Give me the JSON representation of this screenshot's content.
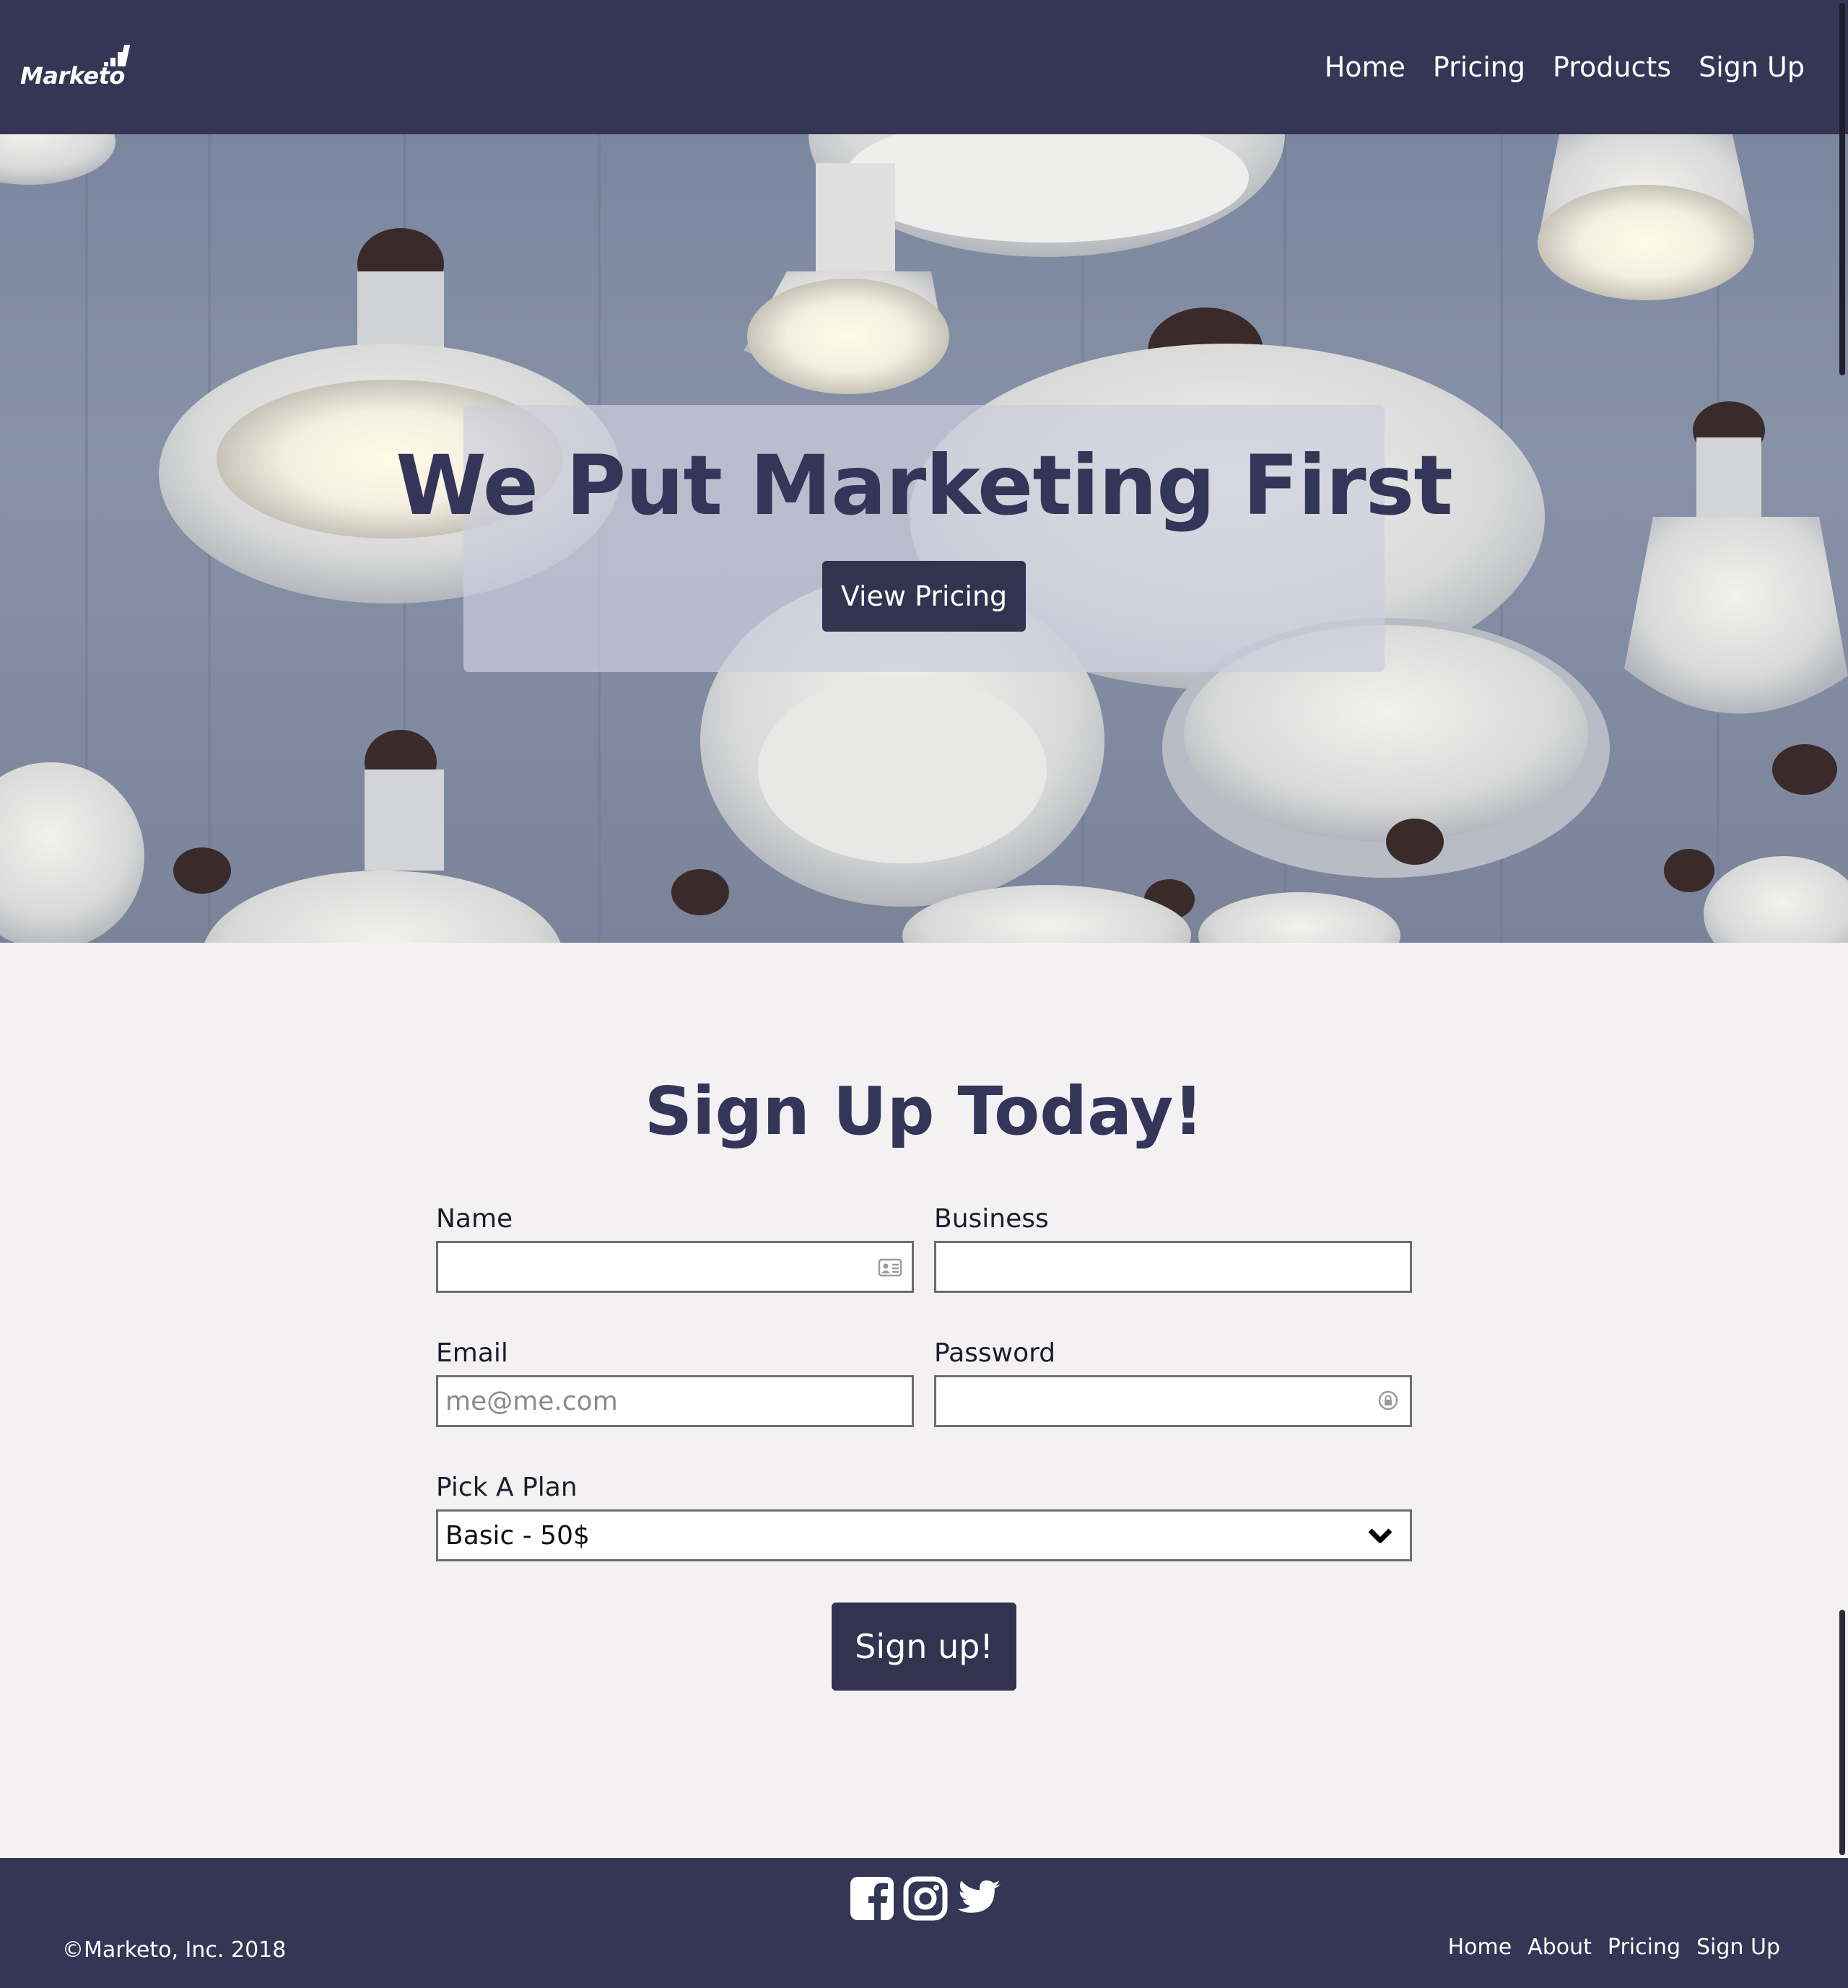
{
  "navbar": {
    "logo_text": "Marketo",
    "links": [
      "Home",
      "Pricing",
      "Products",
      "Sign Up"
    ]
  },
  "hero": {
    "title": "We Put Marketing First",
    "button_label": "View Pricing"
  },
  "signup": {
    "title": "Sign Up Today!",
    "name_label": "Name",
    "business_label": "Business",
    "email_label": "Email",
    "email_placeholder": "me@me.com",
    "password_label": "Password",
    "plan_label": "Pick A Plan",
    "plan_selected": "Basic - 50$",
    "submit_label": "Sign up!"
  },
  "footer": {
    "copyright": "©Marketo, Inc. 2018",
    "links": [
      "Home",
      "About",
      "Pricing",
      "Sign Up"
    ],
    "social_icons": [
      "facebook-icon",
      "instagram-icon",
      "twitter-icon"
    ]
  },
  "colors": {
    "primary": "#353556",
    "button": "#33334f",
    "background": "#f3f1f2",
    "footer": "#353556"
  }
}
